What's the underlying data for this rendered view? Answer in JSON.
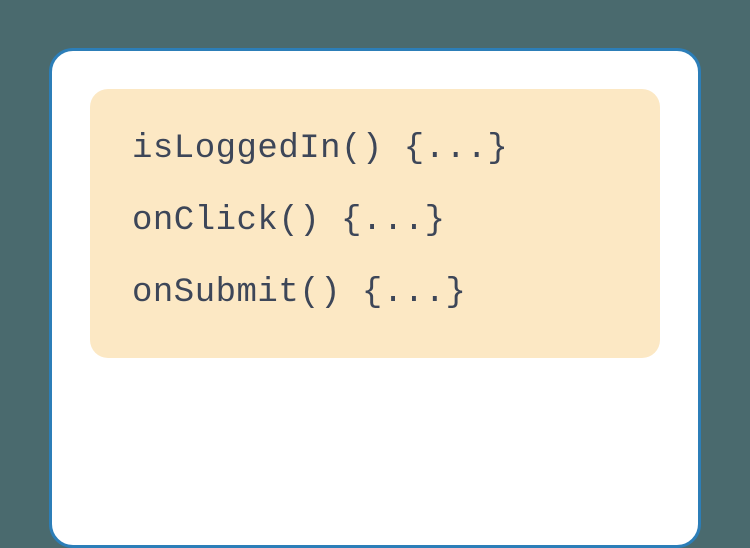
{
  "code": {
    "lines": [
      "isLoggedIn() {...}",
      "onClick() {...}",
      "onSubmit() {...}"
    ]
  }
}
